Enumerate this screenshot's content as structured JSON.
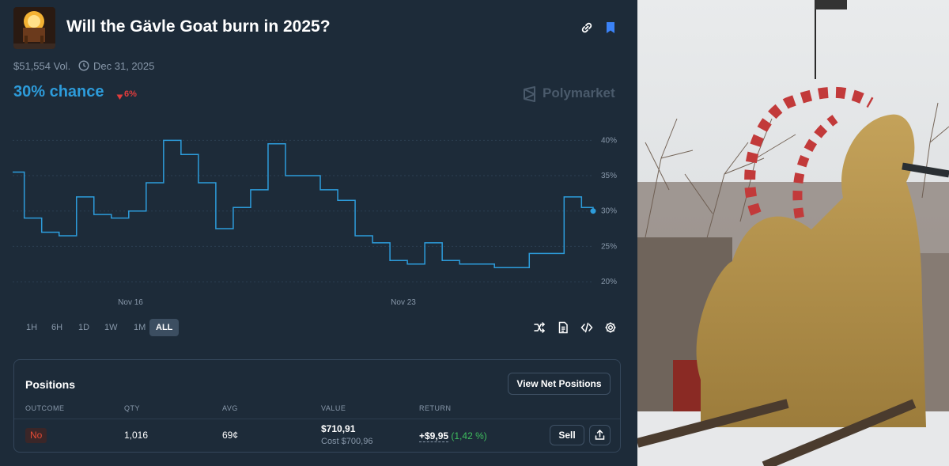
{
  "market": {
    "title": "Will the Gävle Goat burn in 2025?",
    "volume": "$51,554 Vol.",
    "end_date": "Dec 31, 2025",
    "chance": "30% chance",
    "delta": "6%",
    "brand": "Polymarket"
  },
  "header_icons": [
    "link-icon",
    "bookmark-icon"
  ],
  "toolbar_icons": [
    "shuffle-icon",
    "document-icon",
    "code-icon",
    "gear-icon"
  ],
  "ranges": [
    "1H",
    "6H",
    "1D",
    "1W",
    "1M",
    "ALL"
  ],
  "active_range": "ALL",
  "colors": {
    "line": "#2d9cdb",
    "bookmark": "#3b82f6",
    "negative": "#e23c3c",
    "positive": "#3fbf5e"
  },
  "chart_data": {
    "type": "line",
    "x_labels": [
      "Nov 16",
      "Nov 23"
    ],
    "y_ticks": [
      "20%",
      "25%",
      "30%",
      "35%",
      "40%"
    ],
    "ylim": [
      19,
      42.5
    ],
    "x_index": [
      0,
      2,
      5,
      8,
      11,
      14,
      17,
      20,
      23,
      26,
      29,
      32,
      35,
      38,
      41,
      44,
      47,
      50,
      53,
      56,
      59,
      62,
      65,
      68,
      71,
      74,
      77,
      80,
      83,
      86,
      89,
      92,
      95,
      98,
      100
    ],
    "series": [
      {
        "values": [
          35.5,
          29,
          27,
          26.5,
          32,
          29.5,
          29,
          30,
          34,
          40,
          38,
          34,
          27.5,
          30.5,
          33,
          39.5,
          35,
          35,
          33,
          31.5,
          26.5,
          25.5,
          23,
          22.5,
          25.5,
          23,
          22.5,
          22.5,
          22,
          22,
          24,
          24,
          32,
          30.5,
          30
        ]
      }
    ]
  },
  "positions": {
    "title": "Positions",
    "view_net_label": "View Net Positions",
    "headers": [
      "OUTCOME",
      "QTY",
      "AVG",
      "VALUE",
      "RETURN"
    ],
    "row": {
      "outcome": "No",
      "qty": "1,016",
      "avg": "69¢",
      "value": "$710,91",
      "cost": "Cost $700,96",
      "return_amount": "+$9,95",
      "return_pct": "(1,42 %)",
      "sell_label": "Sell"
    }
  }
}
